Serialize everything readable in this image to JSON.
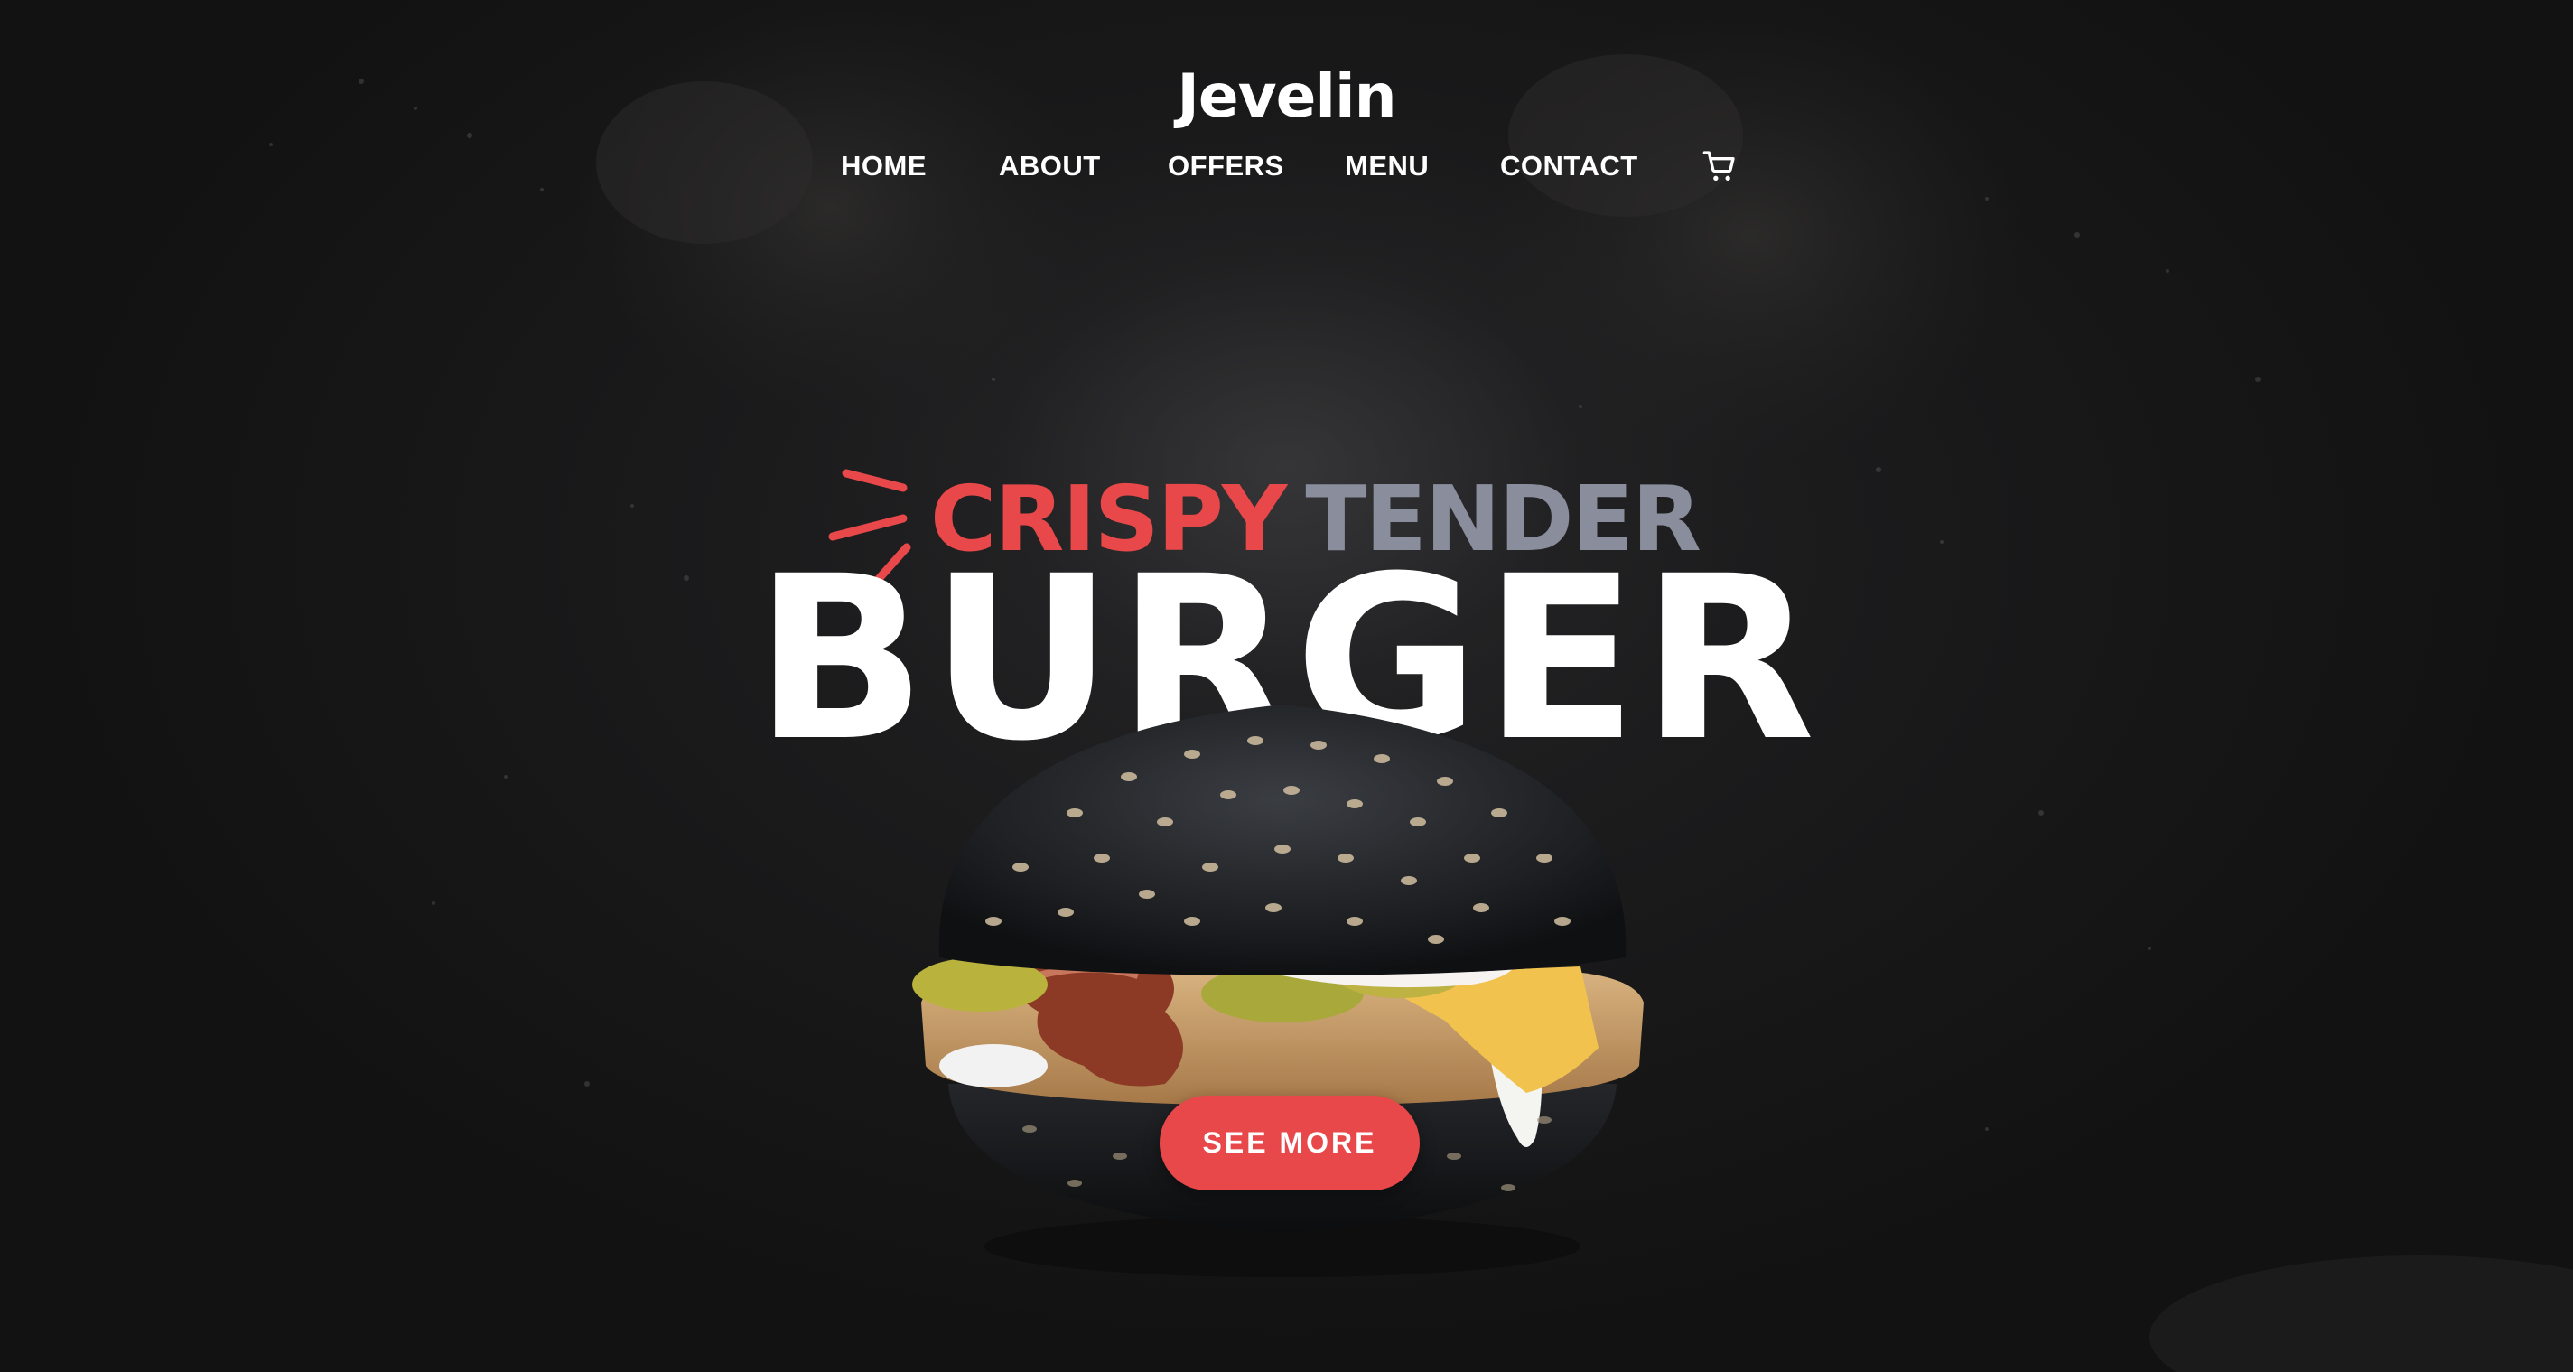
{
  "brand": {
    "logo_text": "Jevelin"
  },
  "nav": {
    "items": [
      {
        "label": "HOME"
      },
      {
        "label": "ABOUT"
      },
      {
        "label": "OFFERS"
      },
      {
        "label": "MENU"
      },
      {
        "label": "CONTACT"
      }
    ],
    "cart_icon": "shopping-cart-icon"
  },
  "hero": {
    "tagline_primary": "CRISPY",
    "tagline_secondary": "TENDER",
    "headline": "BURGER",
    "cta_label": "SEE MORE",
    "image": "black-bun-burger-photo"
  },
  "colors": {
    "accent": "#e8484a",
    "tagline_gray": "#8a8d9b",
    "background": "#161616",
    "text": "#ffffff"
  }
}
